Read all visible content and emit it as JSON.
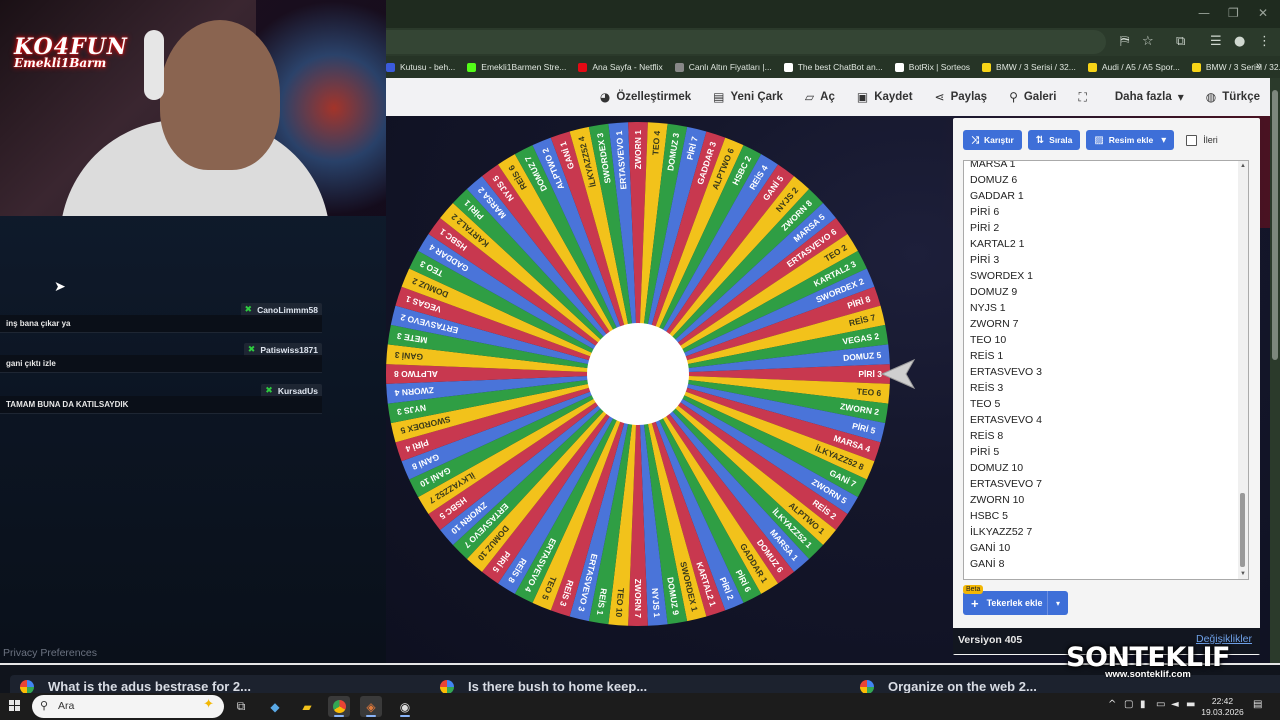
{
  "browser": {
    "bookmarks": [
      {
        "label": "Kutusu - beh...",
        "color": "#3b5bdb"
      },
      {
        "label": "Emekli1Barmen Stre...",
        "color": "#53fc18"
      },
      {
        "label": "Ana Sayfa - Netflix",
        "color": "#e50914"
      },
      {
        "label": "Canlı Altın Fiyatları |...",
        "color": "#888888"
      },
      {
        "label": "The best ChatBot an...",
        "color": "#ffffff"
      },
      {
        "label": "BotRix | Sorteos",
        "color": "#ffffff"
      },
      {
        "label": "BMW / 3 Serisi / 32...",
        "color": "#f7d417"
      },
      {
        "label": "Audi / A5 / A5 Spor...",
        "color": "#f7d417"
      },
      {
        "label": "BMW / 3 Serisi / 32...",
        "color": "#f7d417"
      }
    ],
    "bookmarks_more": "»"
  },
  "toolbar": {
    "customize": "Özelleştirmek",
    "new_wheel": "Yeni Çark",
    "open": "Aç",
    "save": "Kaydet",
    "share": "Paylaş",
    "gallery": "Galeri",
    "more": "Daha fazla",
    "language": "Türkçe"
  },
  "wheel": {
    "slice_colors": [
      "#c8384f",
      "#f2c21b",
      "#2f9e44",
      "#4a74d9"
    ],
    "labels": [
      "PİRİ 3",
      "TEO 6",
      "ZWORN 2",
      "PİRİ 5",
      "MARSA 4",
      "İLKYAZZ52 8",
      "GANİ 7",
      "ZWORN 5",
      "REİS 2",
      "ALPTWO 1",
      "İLKYAZZ52 1",
      "MARSA 1",
      "DOMUZ 6",
      "GADDAR 1",
      "PİRİ 6",
      "PİRİ 2",
      "KARTAL2 1",
      "SWORDEX 1",
      "DOMUZ 9",
      "NYJS 1",
      "ZWORN 7",
      "TEO 10",
      "REİS 1",
      "ERTASVEVO 3",
      "REİS 3",
      "TEO 5",
      "ERTASVEVO 4",
      "REİS 8",
      "PİRİ 5",
      "DOMUZ 10",
      "ERTASVEVO 7",
      "ZWORN 10",
      "HSBC 5",
      "İLKYAZZ52 7",
      "GANİ 10",
      "GANİ 8",
      "PİRİ 4",
      "SWORDEX 5",
      "NYJS 3",
      "ZWORN 4",
      "ALPTWO 8",
      "GANİ 3",
      "METE 3",
      "ERTASVEVO 2",
      "VEGAS 1",
      "DOMUZ 2",
      "TEO 3",
      "GADDAR 4",
      "HSBC 1",
      "KARTAL2 2",
      "PİRİ 1",
      "MARSA 2",
      "NYJS 5",
      "REİS 6",
      "DOMUZ 7",
      "ALPTWO 2",
      "GANİ 1",
      "İLKYAZZ52 4",
      "SWORDEX 3",
      "ERTASVEVO 1",
      "ZWORN 1",
      "TEO 4",
      "DOMUZ 3",
      "PİRİ 7",
      "GADDAR 3",
      "ALPTWO 6",
      "HSBC 2",
      "REİS 4",
      "GANİ 5",
      "NYJS 2",
      "ZWORN 8",
      "MARSA 5",
      "ERTASVEVO 6",
      "TEO 2",
      "KARTAL2 3",
      "SWORDEX 2",
      "PİRİ 8",
      "REİS 7",
      "VEGAS 2",
      "DOMUZ 5"
    ]
  },
  "panel": {
    "shuffle": "Karıştır",
    "sort": "Sırala",
    "add_image": "Resim ekle",
    "advanced": "İleri",
    "entries": [
      "MARSA 1",
      "DOMUZ 6",
      "GADDAR 1",
      "PİRİ 6",
      "PİRİ 2",
      "KARTAL2 1",
      "PİRİ 3",
      "SWORDEX 1",
      "DOMUZ 9",
      "NYJS 1",
      "ZWORN 7",
      "TEO 10",
      "REİS 1",
      "ERTASVEVO 3",
      "REİS 3",
      "TEO 5",
      "ERTASVEVO 4",
      "REİS 8",
      "PİRİ 5",
      "DOMUZ 10",
      "ERTASVEVO 7",
      "ZWORN 10",
      "HSBC 5",
      "İLKYAZZ52 7",
      "GANİ 10",
      "GANİ 8"
    ],
    "beta": "Beta",
    "wheels_button": "Tekerlek ekle",
    "version": "Versiyon 405",
    "changelog": "Değişiklikler"
  },
  "overlay": {
    "logo_line1": "KO4FUN",
    "logo_line2": "Emekli1Barm",
    "chat": [
      {
        "user": "CanoLimmm58",
        "text": "inş bana çıkar ya"
      },
      {
        "user": "Patiswiss1871",
        "text": "gani çıktı izle"
      },
      {
        "user": "KursadUs",
        "text": "TAMAM BUNA DA KATILSAYDIK"
      }
    ],
    "privacy": "Privacy Preferences",
    "brand_title": "SONTEKLIF",
    "brand_url": "www.sonteklif.com"
  },
  "bottom_cards": [
    "What is the adus bestrase for 2...",
    "Is there bush to home keep...",
    "Organize on the web 2..."
  ],
  "taskbar": {
    "search_placeholder": "Ara",
    "time": "22:42",
    "date": "19.03.2026"
  }
}
